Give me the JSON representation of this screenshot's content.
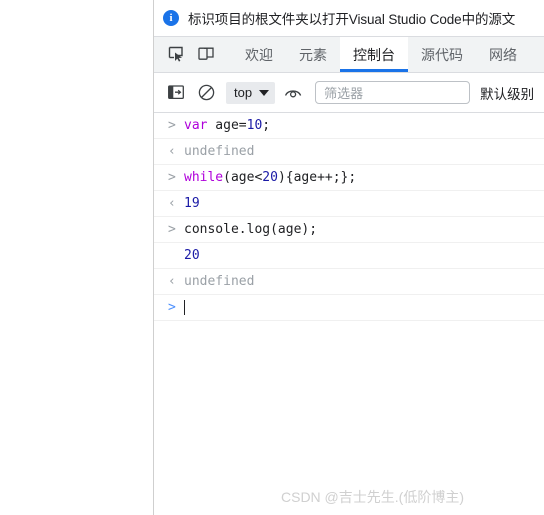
{
  "infobar": {
    "icon": "info-icon",
    "message": "标识项目的根文件夹以打开Visual Studio Code中的源文"
  },
  "tabbar": {
    "inspect_icon": "inspect-element-icon",
    "device_icon": "device-toolbar-icon",
    "tabs": [
      {
        "label": "欢迎",
        "active": false
      },
      {
        "label": "元素",
        "active": false
      },
      {
        "label": "控制台",
        "active": true
      },
      {
        "label": "源代码",
        "active": false
      },
      {
        "label": "网络",
        "active": false
      }
    ],
    "active_tab": "控制台",
    "accent_color": "#1a73e8"
  },
  "console_toolbar": {
    "sidebar_icon": "console-sidebar-icon",
    "clear_icon": "clear-console-icon",
    "context_label": "top",
    "caret_icon": "chevron-down-icon",
    "eye_icon": "live-expression-eye-icon",
    "filter_placeholder": "筛选器",
    "filter_value": "",
    "levels_label": "默认级别"
  },
  "console_messages": [
    {
      "gutter": ">",
      "gutter_kind": "input",
      "tokens": [
        {
          "text": "var",
          "kind": "kw"
        },
        {
          "text": " age=",
          "kind": "plain"
        },
        {
          "text": "10",
          "kind": "num"
        },
        {
          "text": ";",
          "kind": "plain"
        }
      ]
    },
    {
      "gutter": "‹",
      "gutter_kind": "output",
      "tokens": [
        {
          "text": "undefined",
          "kind": "undef"
        }
      ]
    },
    {
      "gutter": ">",
      "gutter_kind": "input",
      "tokens": [
        {
          "text": "while",
          "kind": "kw"
        },
        {
          "text": "(age<",
          "kind": "plain"
        },
        {
          "text": "20",
          "kind": "num"
        },
        {
          "text": "){age++;};",
          "kind": "plain"
        }
      ]
    },
    {
      "gutter": "‹",
      "gutter_kind": "output",
      "tokens": [
        {
          "text": "19",
          "kind": "num"
        }
      ]
    },
    {
      "gutter": ">",
      "gutter_kind": "input",
      "tokens": [
        {
          "text": "console.log(age);",
          "kind": "plain"
        }
      ]
    },
    {
      "gutter": "",
      "gutter_kind": "log",
      "tokens": [
        {
          "text": "20",
          "kind": "num"
        }
      ]
    },
    {
      "gutter": "‹",
      "gutter_kind": "output",
      "tokens": [
        {
          "text": "undefined",
          "kind": "undef"
        }
      ]
    },
    {
      "gutter": ">",
      "gutter_kind": "prompt",
      "tokens": [],
      "cursor": true
    }
  ],
  "watermark": {
    "text": "CSDN @吉士先生.(低阶博主)"
  }
}
